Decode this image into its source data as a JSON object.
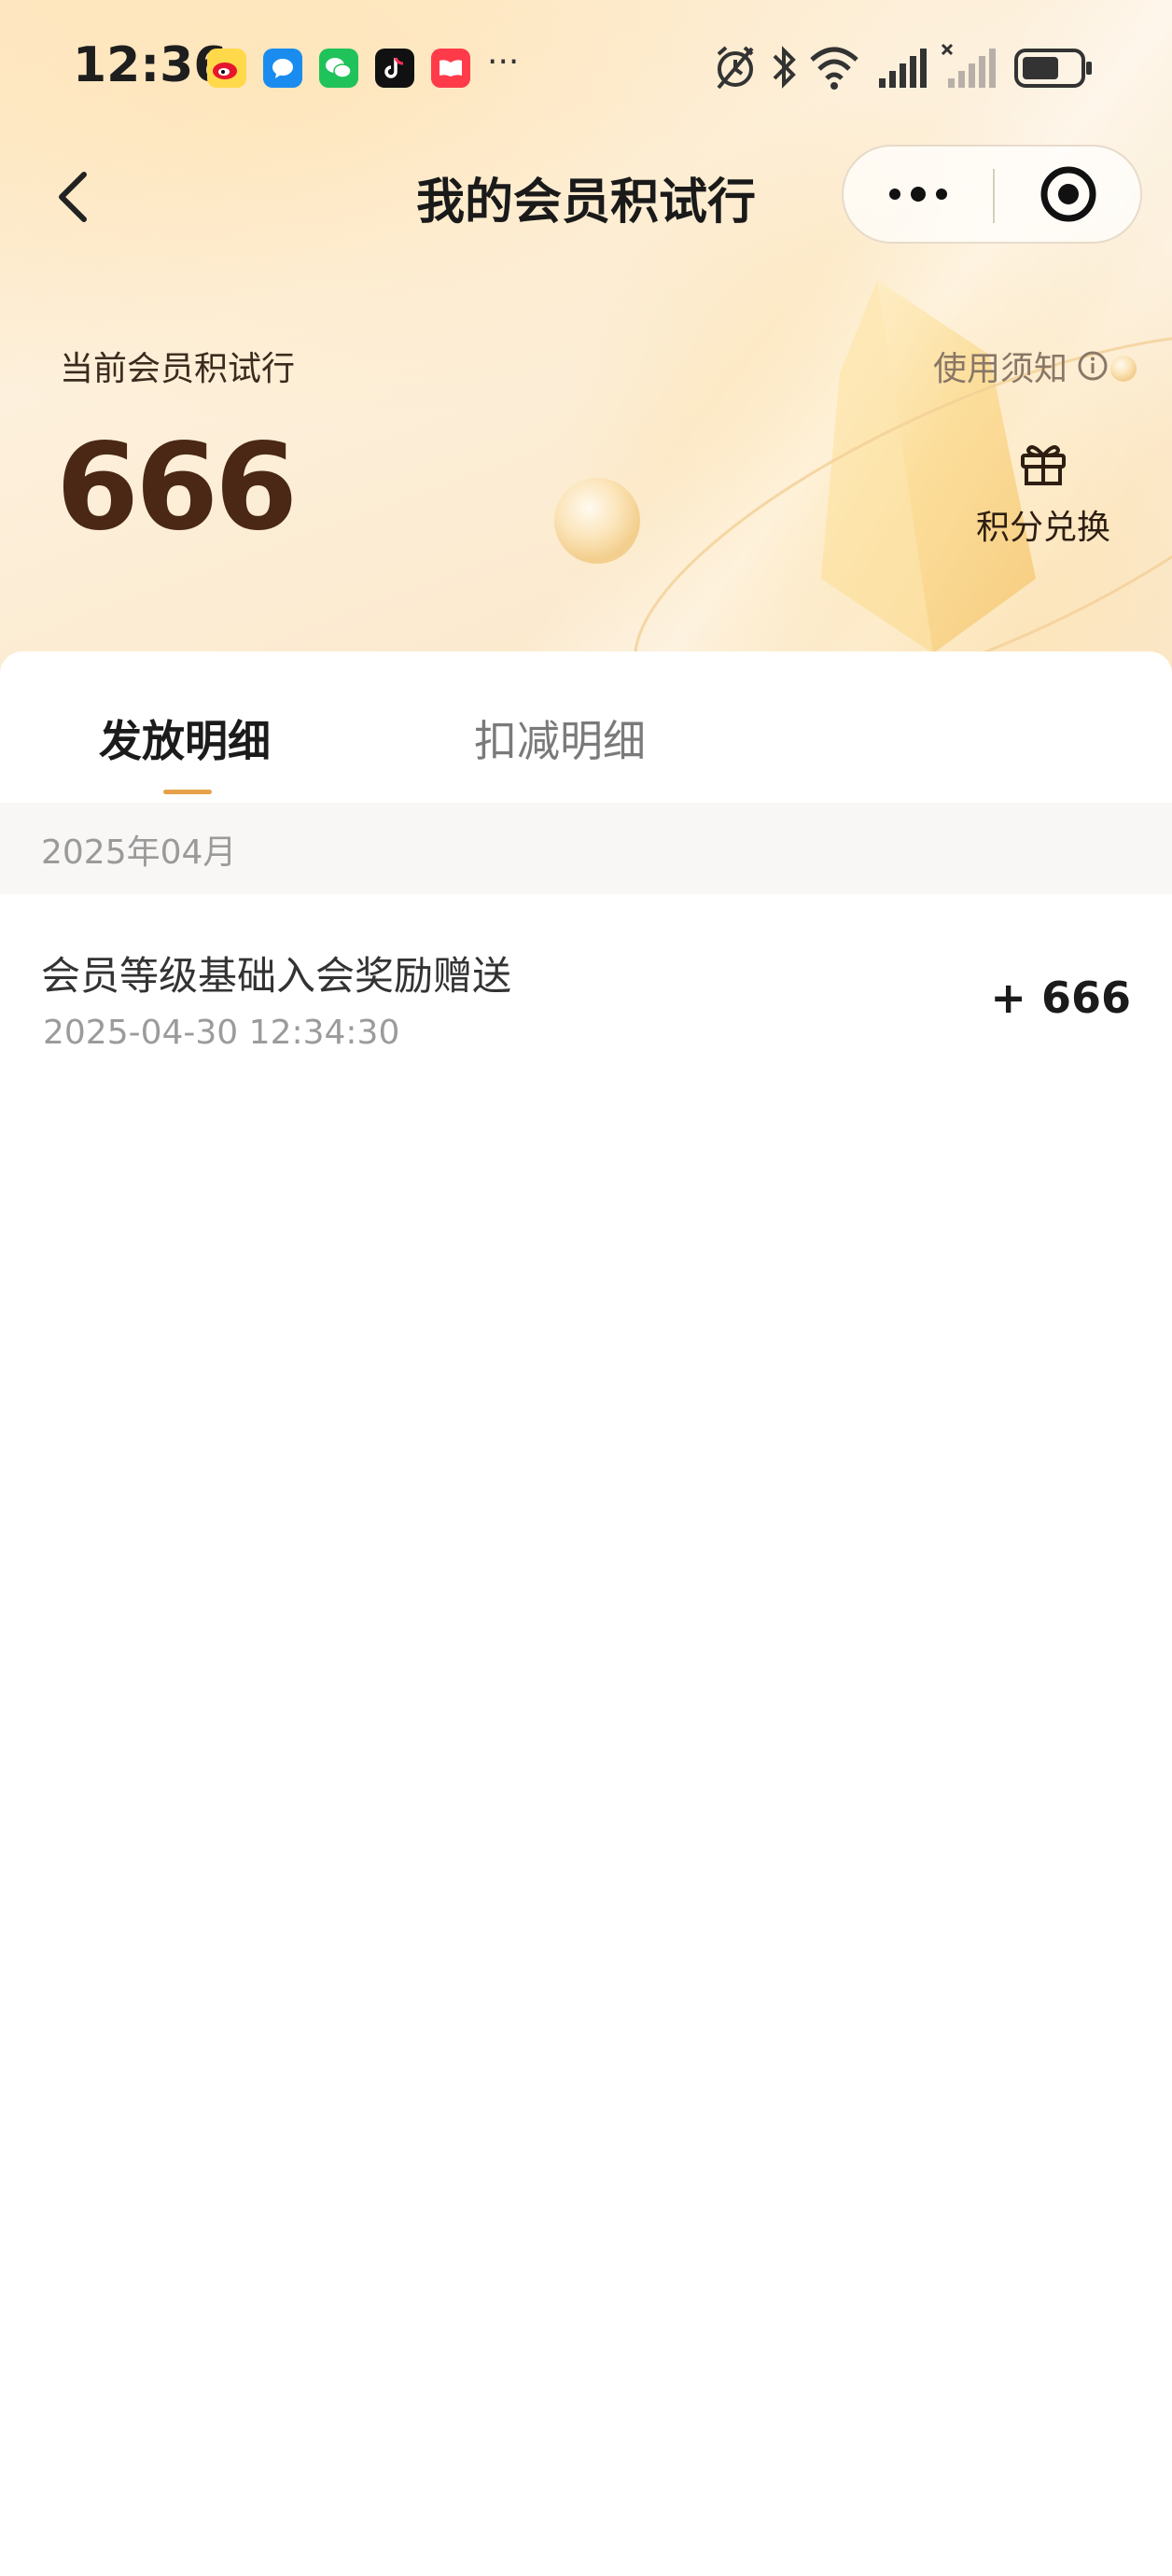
{
  "status_bar": {
    "time": "12:36",
    "notification_icons": [
      "weibo-icon",
      "message-icon",
      "wechat-icon",
      "tiktok-icon",
      "red-book-icon"
    ],
    "more": "···",
    "right_icons": [
      "alarm-icon",
      "bluetooth-icon",
      "wifi-icon",
      "signal-icon",
      "signal-no-service-icon",
      "battery-icon"
    ]
  },
  "navbar": {
    "title": "我的会员积试行"
  },
  "points": {
    "label": "当前会员积试行",
    "value": "666",
    "notice_label": "使用须知",
    "exchange_label": "积分兑换"
  },
  "tabs": [
    {
      "label": "发放明细",
      "active": true
    },
    {
      "label": "扣减明细",
      "active": false
    }
  ],
  "records": {
    "month": "2025年04月",
    "items": [
      {
        "title": "会员等级基础入会奖励赠送",
        "time": "2025-04-30 12:34:30",
        "amount": "+ 666"
      }
    ]
  },
  "colors": {
    "accent": "#e6a24a",
    "points_value": "#4a2815",
    "hero_bg": "#fdeed6"
  }
}
